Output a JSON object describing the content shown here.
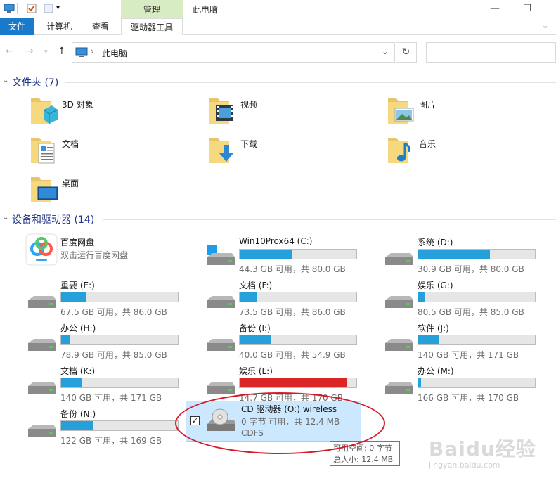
{
  "titlebar": {
    "context_tab": "管理",
    "window_title": "此电脑",
    "minimize": "—",
    "maximize": "☐"
  },
  "ribbon": {
    "tabs": [
      {
        "label": "文件"
      },
      {
        "label": "计算机"
      },
      {
        "label": "查看"
      },
      {
        "label": "驱动器工具"
      }
    ]
  },
  "address": {
    "path": "此电脑",
    "separator": "›"
  },
  "groups": {
    "folders_title": "文件夹 (7)",
    "drives_title": "设备和驱动器 (14)"
  },
  "folders": [
    {
      "label": "3D 对象",
      "icon": "3d-objects-folder-icon"
    },
    {
      "label": "视频",
      "icon": "videos-folder-icon"
    },
    {
      "label": "图片",
      "icon": "pictures-folder-icon"
    },
    {
      "label": "文档",
      "icon": "documents-folder-icon"
    },
    {
      "label": "下载",
      "icon": "downloads-folder-icon"
    },
    {
      "label": "音乐",
      "icon": "music-folder-icon"
    },
    {
      "label": "桌面",
      "icon": "desktop-folder-icon"
    }
  ],
  "app_item": {
    "name": "百度网盘",
    "sub": "双击运行百度网盘"
  },
  "drives": [
    {
      "name": "Win10Prox64 (C:)",
      "info": "44.3 GB 可用，共 80.0 GB",
      "used_fraction": 0.446
    },
    {
      "name": "系统 (D:)",
      "info": "30.9 GB 可用，共 80.0 GB",
      "used_fraction": 0.614
    },
    {
      "name": "重要 (E:)",
      "info": "67.5 GB 可用，共 86.0 GB",
      "used_fraction": 0.215
    },
    {
      "name": "文档 (F:)",
      "info": "73.5 GB 可用，共 86.0 GB",
      "used_fraction": 0.145
    },
    {
      "name": "娱乐 (G:)",
      "info": "80.5 GB 可用，共 85.0 GB",
      "used_fraction": 0.053
    },
    {
      "name": "办公 (H:)",
      "info": "78.9 GB 可用，共 85.0 GB",
      "used_fraction": 0.072
    },
    {
      "name": "备份 (I:)",
      "info": "40.0 GB 可用，共 54.9 GB",
      "used_fraction": 0.271
    },
    {
      "name": "软件 (J:)",
      "info": "140 GB 可用，共 171 GB",
      "used_fraction": 0.181
    },
    {
      "name": "文档 (K:)",
      "info": "140 GB 可用，共 171 GB",
      "used_fraction": 0.181
    },
    {
      "name": "娱乐 (L:)",
      "info": "14.7 GB 可用，共 170 GB",
      "used_fraction": 0.914
    },
    {
      "name": "办公 (M:)",
      "info": "166 GB 可用，共 170 GB",
      "used_fraction": 0.024
    },
    {
      "name": "备份 (N:)",
      "info": "122 GB 可用，共 169 GB",
      "used_fraction": 0.278
    }
  ],
  "cd_drive": {
    "name": "CD 驱动器 (O:) wireless",
    "info": "0 字节 可用，共 12.4 MB",
    "fs": "CDFS",
    "checked": "✓"
  },
  "tooltip": {
    "line1": "可用空间: 0 字节",
    "line2": "总大小: 12.4 MB"
  },
  "watermark": {
    "brand": "Baidu经验",
    "url": "jingyan.baidu.com"
  },
  "colors": {
    "accent": "#1979ca",
    "bar_normal": "#26a0da",
    "bar_full": "#da2626",
    "selection": "#cce8ff",
    "annotation": "#d7192b"
  }
}
